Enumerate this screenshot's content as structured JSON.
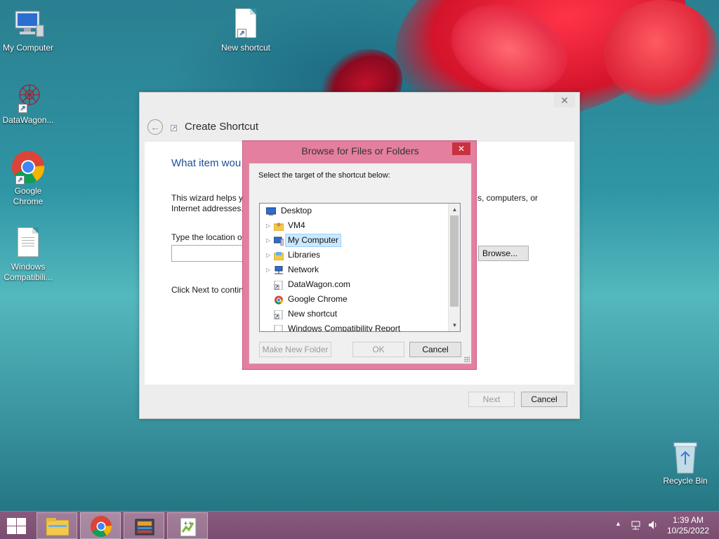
{
  "desktop": {
    "icons": [
      {
        "label": "My Computer"
      },
      {
        "label": "New shortcut"
      },
      {
        "label": "DataWagon..."
      },
      {
        "label": "Google\nChrome"
      },
      {
        "label": "Windows\nCompatibili..."
      }
    ],
    "recycle_bin": "Recycle Bin"
  },
  "wizard": {
    "title": "Create Shortcut",
    "close": "✕",
    "heading": "What item wou",
    "intro_line1_left": "This wizard helps y",
    "intro_line1_right": "s, computers, or",
    "intro_line2": "Internet addresses.",
    "location_label": "Type the location o",
    "browse_button": "Browse...",
    "next_hint": "Click Next to contin",
    "next_button": "Next",
    "cancel_button": "Cancel"
  },
  "browse_dialog": {
    "title": "Browse for Files or Folders",
    "close": "✕",
    "instruction": "Select the target of the shortcut below:",
    "tree": [
      {
        "label": "Desktop",
        "expandable": false,
        "indent": 0,
        "icon": "desktop-icon"
      },
      {
        "label": "VM4",
        "expandable": true,
        "indent": 1,
        "icon": "user-folder-icon"
      },
      {
        "label": "My Computer",
        "expandable": true,
        "indent": 1,
        "icon": "computer-icon",
        "selected": true
      },
      {
        "label": "Libraries",
        "expandable": true,
        "indent": 1,
        "icon": "libraries-icon"
      },
      {
        "label": "Network",
        "expandable": true,
        "indent": 1,
        "icon": "network-icon"
      },
      {
        "label": "DataWagon.com",
        "expandable": false,
        "indent": 1,
        "icon": "shortcut-icon"
      },
      {
        "label": "Google Chrome",
        "expandable": false,
        "indent": 1,
        "icon": "chrome-icon"
      },
      {
        "label": "New shortcut",
        "expandable": false,
        "indent": 1,
        "icon": "shortcut-icon"
      },
      {
        "label": "Windows Compatibility Report",
        "expandable": false,
        "indent": 1,
        "icon": "document-icon"
      }
    ],
    "make_new_folder": "Make New Folder",
    "ok": "OK",
    "cancel": "Cancel"
  },
  "taskbar": {
    "items": [
      "file-explorer",
      "google-chrome",
      "archive-app",
      "notepad-plus-plus"
    ],
    "clock_time": "1:39 AM",
    "clock_date": "10/25/2022"
  },
  "colors": {
    "dialog_frame": "#e47fa0",
    "close_red": "#c8323e",
    "taskbar": "#7a4d70",
    "selection": "#cce8ff"
  }
}
